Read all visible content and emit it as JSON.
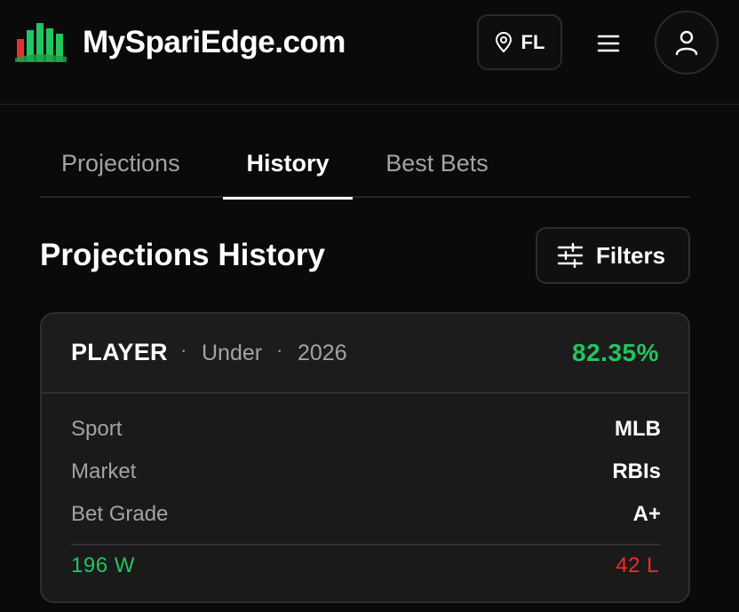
{
  "header": {
    "brand": "MySpariEdge.com",
    "logo_icon": "bar-chart-logo-icon",
    "location_label": "FL",
    "location_icon": "map-pin-icon",
    "menu_icon": "hamburger-menu-icon",
    "profile_icon": "user-icon"
  },
  "tabs": [
    {
      "label": "Projections",
      "active": false
    },
    {
      "label": "History",
      "active": true
    },
    {
      "label": "Best Bets",
      "active": false
    }
  ],
  "page": {
    "title": "Projections History",
    "filters_label": "Filters",
    "filters_icon": "sliders-icon"
  },
  "card": {
    "player": "PLAYER",
    "separator": "·",
    "side": "Under",
    "year": "2026",
    "percent": "82.35%",
    "rows": [
      {
        "key": "Sport",
        "value": "MLB"
      },
      {
        "key": "Market",
        "value": "RBIs"
      },
      {
        "key": "Bet Grade",
        "value": "A+"
      }
    ],
    "wins": "196 W",
    "losses": "42 L"
  },
  "colors": {
    "background": "#0a0a0a",
    "card": "#1a1a1a",
    "positive": "#22c55e",
    "negative": "#ef2b2b",
    "logo_red": "#e0332e",
    "logo_green": "#22c55e"
  }
}
